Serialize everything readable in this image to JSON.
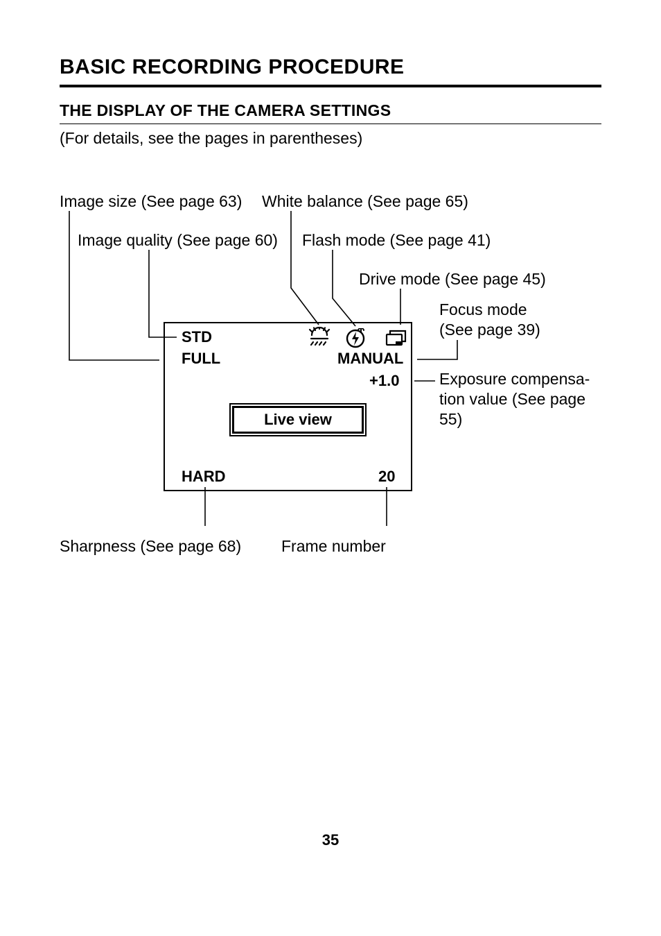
{
  "title": "BASIC RECORDING PROCEDURE",
  "subtitle": "THE DISPLAY OF THE CAMERA SETTINGS",
  "note": "(For details, see the pages in parentheses)",
  "labels": {
    "image_size": "Image size (See page 63)",
    "image_quality": "Image quality (See page 60)",
    "white_balance": "White balance (See page 65)",
    "flash_mode": "Flash mode (See page 41)",
    "drive_mode": "Drive mode (See page 45)",
    "focus_mode_l1": "Focus mode",
    "focus_mode_l2": "(See page 39)",
    "exposure_l1": "Exposure compensa-",
    "exposure_l2": "tion value (See page",
    "exposure_l3": "55)",
    "sharpness": "Sharpness (See page 68)",
    "frame_number": "Frame number"
  },
  "display": {
    "std": "STD",
    "full": "FULL",
    "manual": "MANUAL",
    "plus10": "+1.0",
    "live_view": "Live view",
    "hard": "HARD",
    "twenty": "20"
  },
  "page_number": "35"
}
